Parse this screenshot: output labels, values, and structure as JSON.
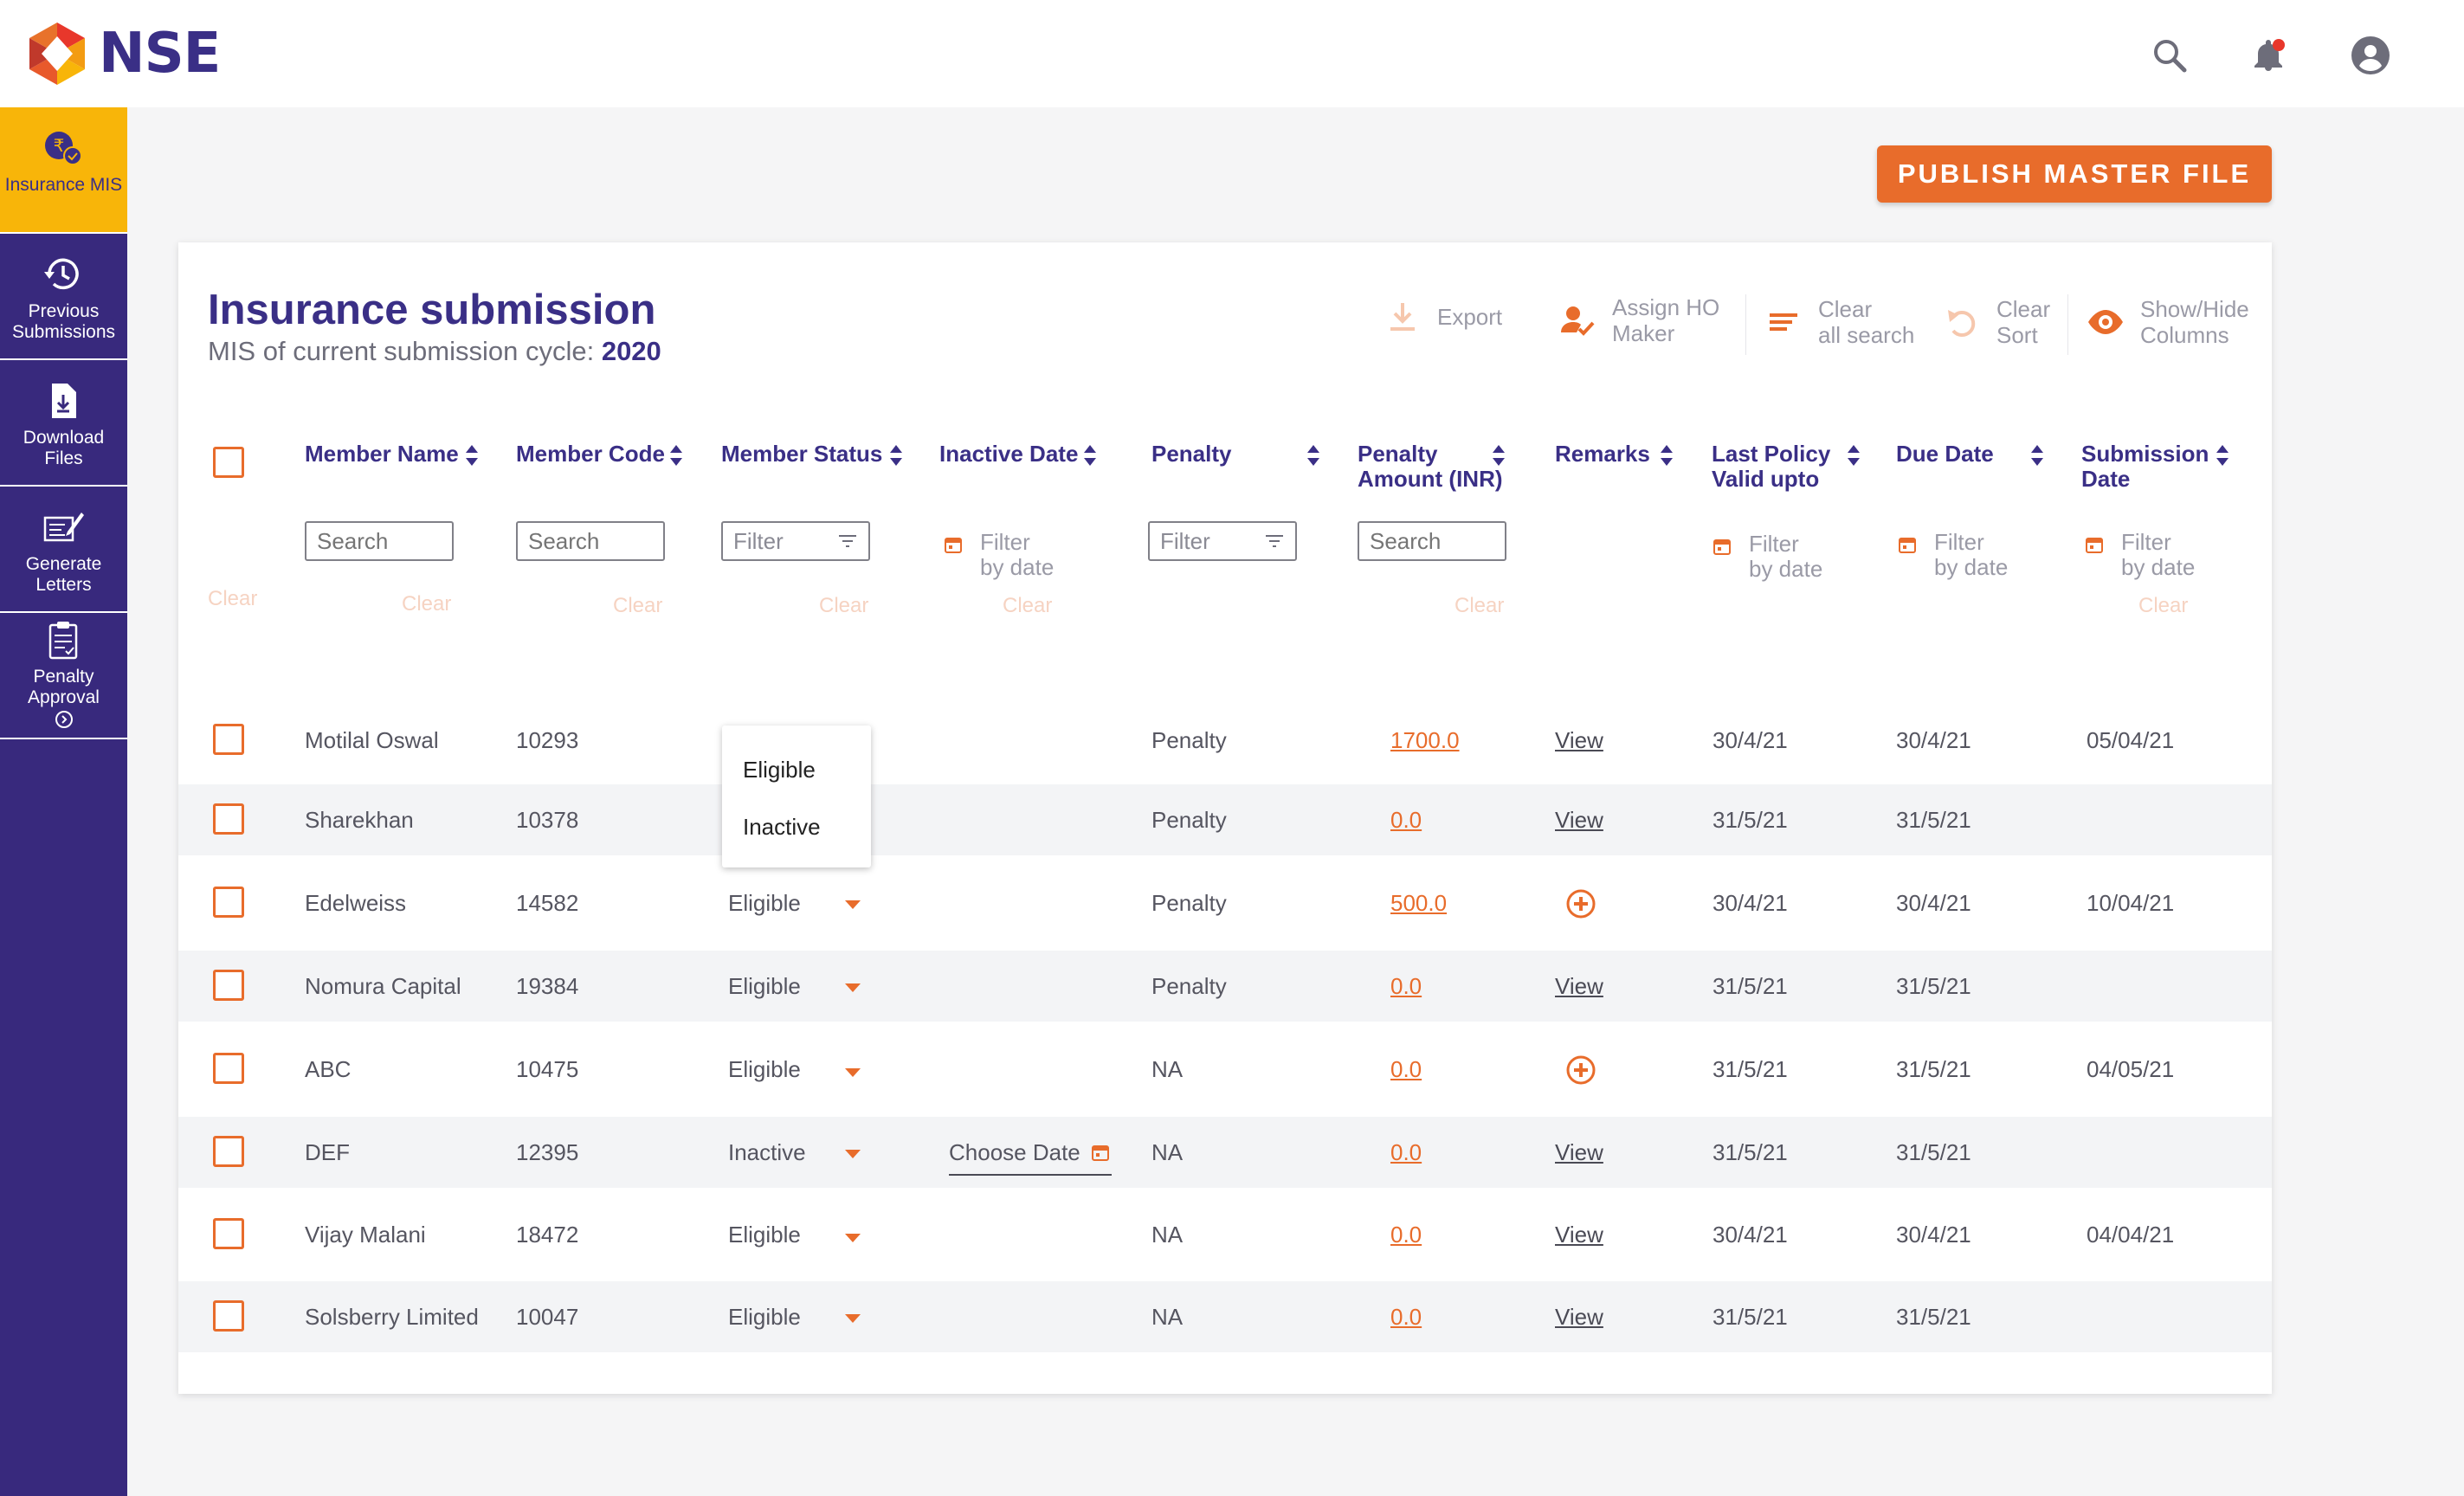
{
  "brand": {
    "name": "NSE"
  },
  "sidebar": {
    "items": [
      {
        "label": "Insurance MIS"
      },
      {
        "label": "Previous Submissions"
      },
      {
        "label": "Download Files"
      },
      {
        "label": "Generate Letters"
      },
      {
        "label": "Penalty Approval"
      }
    ]
  },
  "actions": {
    "publish_label": "PUBLISH MASTER FILE"
  },
  "card": {
    "title": "Insurance submission",
    "subtitle_prefix": "MIS of current submission cycle:",
    "cycle_year": "2020"
  },
  "toolbar": {
    "export": "Export",
    "assign_l1": "Assign HO",
    "assign_l2": "Maker",
    "clear_search_l1": "Clear",
    "clear_search_l2": "all search",
    "clear_sort_l1": "Clear",
    "clear_sort_l2": "Sort",
    "showhide_l1": "Show/Hide",
    "showhide_l2": "Columns"
  },
  "table": {
    "columns": {
      "member_name": "Member Name",
      "member_code": "Member Code",
      "member_status": "Member Status",
      "inactive_date": "Inactive Date",
      "penalty": "Penalty",
      "penalty_amount_l1": "Penalty",
      "penalty_amount_l2": "Amount (INR)",
      "remarks": "Remarks",
      "last_policy_l1": "Last Policy",
      "last_policy_l2": "Valid upto",
      "due_date": "Due Date",
      "submission_l1": "Submission",
      "submission_l2": "Date"
    },
    "filters": {
      "search_placeholder": "Search",
      "filter_label": "Filter",
      "date_filter_l1": "Filter",
      "date_filter_l2": "by date",
      "clear_label": "Clear"
    },
    "rows": [
      {
        "name": "Motilal Oswal",
        "code": "10293",
        "status": "Eligible",
        "inactive_date": "",
        "penalty": "Penalty",
        "amount": "1700.0",
        "remarks": "View",
        "last_policy": "30/4/21",
        "due": "30/4/21",
        "submission": "05/04/21"
      },
      {
        "name": "Sharekhan",
        "code": "10378",
        "status": "",
        "inactive_date": "",
        "penalty": "Penalty",
        "amount": "0.0",
        "remarks": "View",
        "last_policy": "31/5/21",
        "due": "31/5/21",
        "submission": ""
      },
      {
        "name": "Edelweiss",
        "code": "14582",
        "status": "Eligible",
        "inactive_date": "",
        "penalty": "Penalty",
        "amount": "500.0",
        "remarks": "",
        "last_policy": "30/4/21",
        "due": "30/4/21",
        "submission": "10/04/21"
      },
      {
        "name": "Nomura Capital",
        "code": "19384",
        "status": "Eligible",
        "inactive_date": "",
        "penalty": "Penalty",
        "amount": "0.0",
        "remarks": "View",
        "last_policy": "31/5/21",
        "due": "31/5/21",
        "submission": ""
      },
      {
        "name": "ABC",
        "code": "10475",
        "status": "Eligible",
        "inactive_date": "",
        "penalty": "NA",
        "amount": "0.0",
        "remarks": "",
        "last_policy": "31/5/21",
        "due": "31/5/21",
        "submission": "04/05/21"
      },
      {
        "name": "DEF",
        "code": "12395",
        "status": "Inactive",
        "inactive_date": "Choose Date",
        "penalty": "NA",
        "amount": "0.0",
        "remarks": "View",
        "last_policy": "31/5/21",
        "due": "31/5/21",
        "submission": ""
      },
      {
        "name": "Vijay Malani",
        "code": "18472",
        "status": "Eligible",
        "inactive_date": "",
        "penalty": "NA",
        "amount": "0.0",
        "remarks": "View",
        "last_policy": "30/4/21",
        "due": "30/4/21",
        "submission": "04/04/21"
      },
      {
        "name": "Solsberry Limited",
        "code": "10047",
        "status": "Eligible",
        "inactive_date": "",
        "penalty": "NA",
        "amount": "0.0",
        "remarks": "View",
        "last_policy": "31/5/21",
        "due": "31/5/21",
        "submission": ""
      }
    ]
  },
  "status_dropdown": {
    "options": [
      "Eligible",
      "Inactive"
    ]
  },
  "colors": {
    "primary": "#3a2f86",
    "accent": "#e86c2b",
    "highlight": "#f8b509"
  },
  "icons": {
    "search": "search-icon",
    "bell": "bell-icon",
    "account": "account-icon",
    "export": "download-icon",
    "assign": "user-check-icon",
    "clear_search": "clear-filter-icon",
    "clear_sort": "undo-icon",
    "showhide": "eye-icon",
    "calendar": "calendar-icon",
    "remarks_add": "plus-circle-icon"
  }
}
